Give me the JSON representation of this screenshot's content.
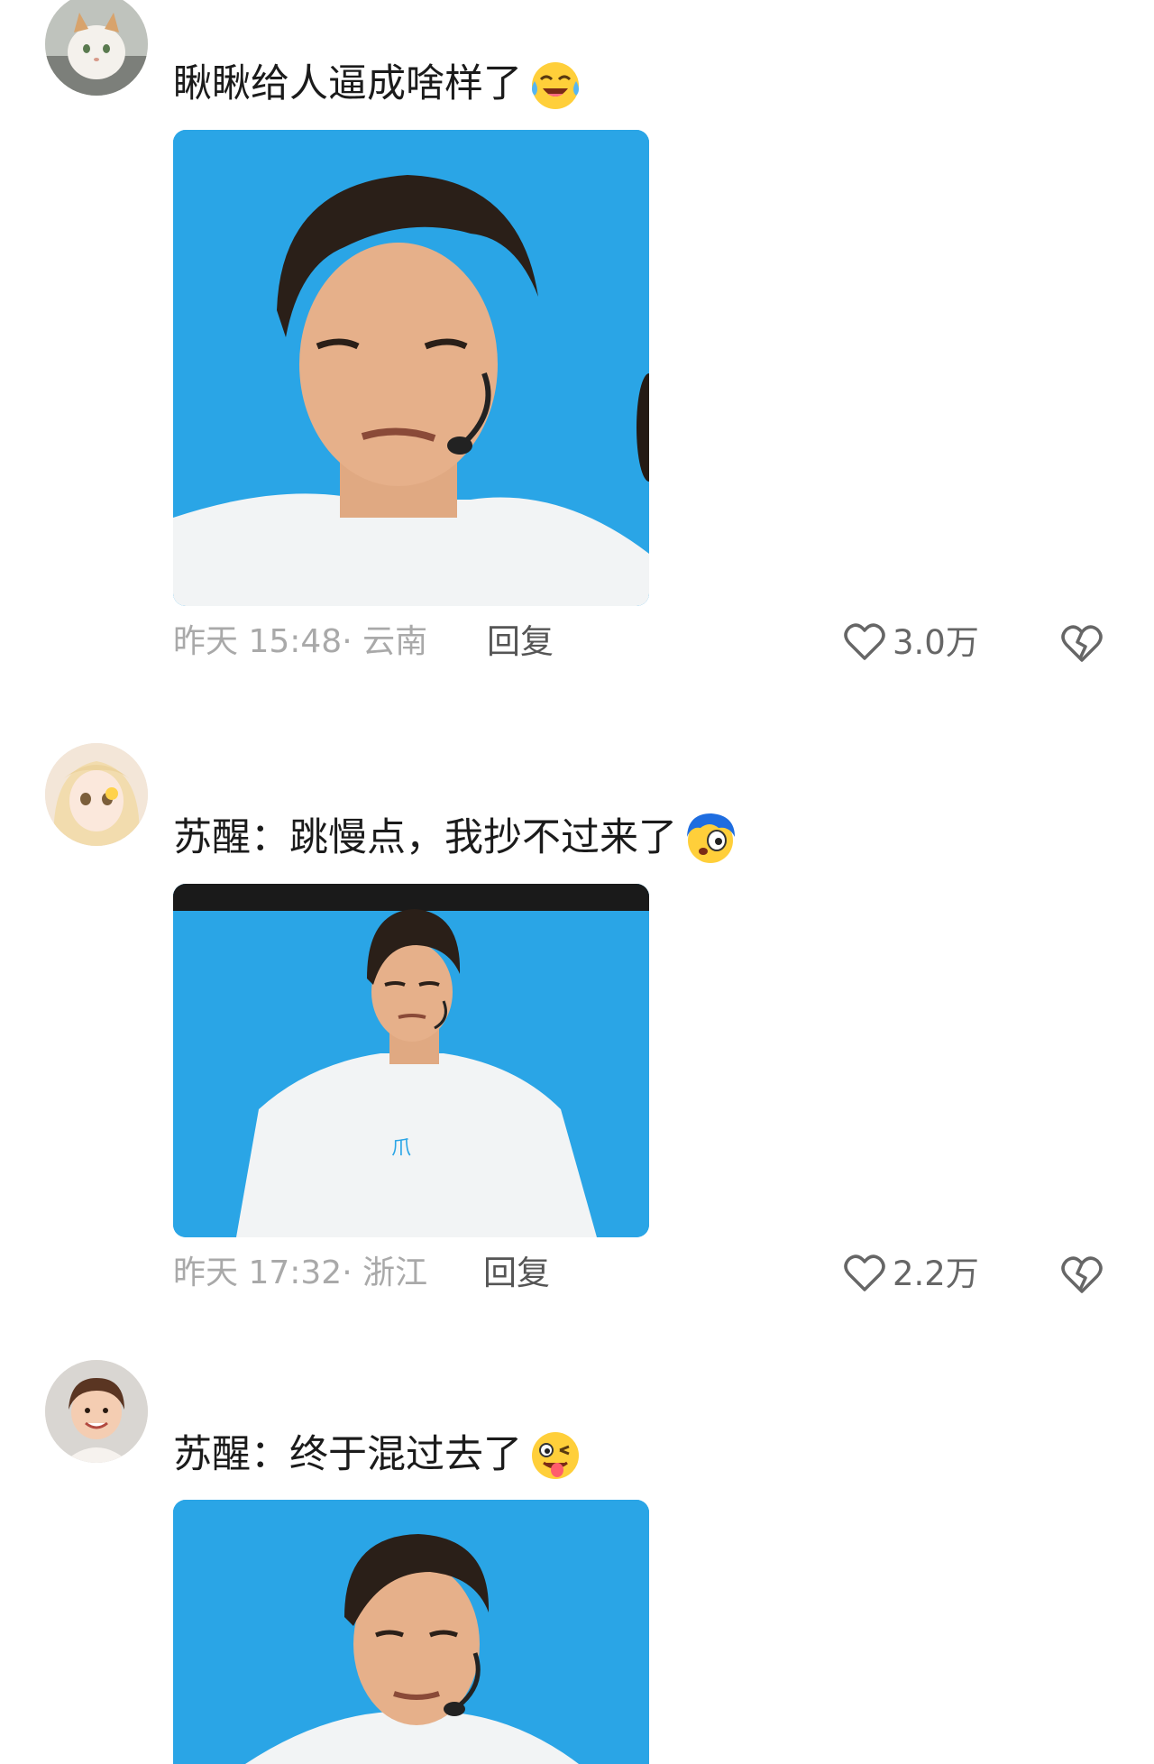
{
  "comments": [
    {
      "text": "瞅瞅给人逼成啥样了",
      "emoji": "crying-laughing-emoji",
      "time": "昨天 15:48· 云南",
      "reply": "回复",
      "likes": "3.0万"
    },
    {
      "text": "苏醒：跳慢点，我抄不过来了",
      "emoji": "shocked-blue-hair-emoji",
      "time": "昨天 17:32· 浙江",
      "reply": "回复",
      "likes": "2.2万"
    },
    {
      "text": "苏醒：终于混过去了",
      "emoji": "winking-tongue-emoji"
    }
  ],
  "colors": {
    "photo_background": "#2aa5e6",
    "time_text": "#a9a9a9",
    "reply_text": "#555555"
  }
}
